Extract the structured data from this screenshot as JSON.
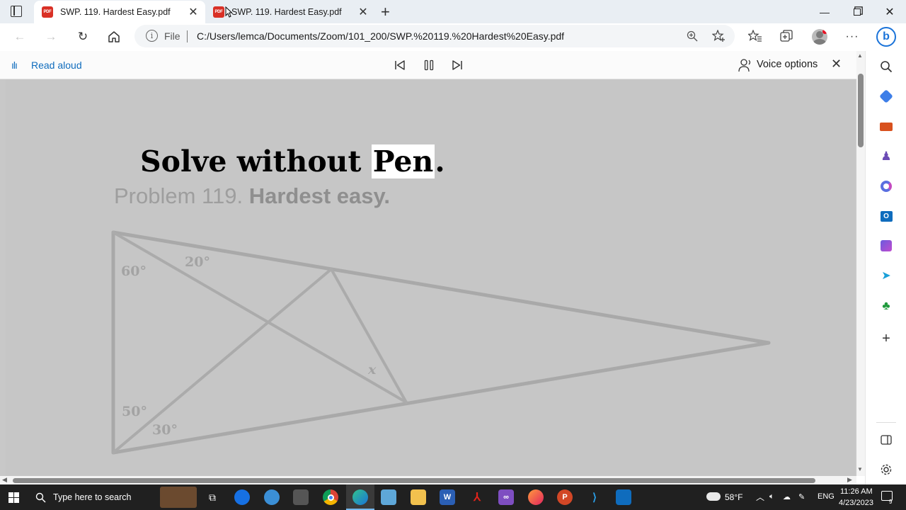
{
  "tabs": [
    {
      "title": "SWP. 119. Hardest Easy.pdf",
      "active": true
    },
    {
      "title": "SWP. 119. Hardest Easy.pdf",
      "active": false
    }
  ],
  "address": {
    "scheme_label": "File",
    "url": "C:/Users/lemca/Documents/Zoom/101_200/SWP.%20119.%20Hardest%20Easy.pdf"
  },
  "read_aloud": {
    "label": "Read aloud",
    "voice_options": "Voice options"
  },
  "document": {
    "title_main": "Solve without ",
    "title_highlight": "Pen",
    "title_end": ".",
    "subtitle_plain": "Problem 119.  ",
    "subtitle_bold": "Hardest easy.",
    "angles": {
      "a1": "60°",
      "a2": "20°",
      "a3": "50°",
      "a4": "30°",
      "unknown": "x"
    }
  },
  "taskbar": {
    "search_placeholder": "Type here to search",
    "weather": "58°F",
    "language": "ENG",
    "time": "11:26 AM",
    "date": "4/23/2023",
    "notification_count": "9"
  },
  "colors": {
    "accent": "#0f6cbd",
    "page_bg": "#c6c6c6",
    "line": "#a9a9a9"
  }
}
